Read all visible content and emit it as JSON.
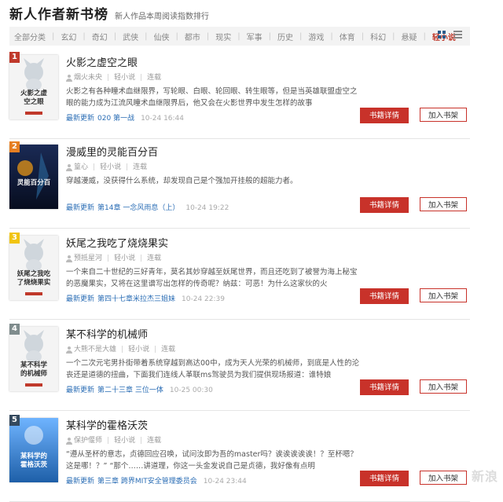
{
  "header": {
    "title": "新人作者新书榜",
    "subtitle": "新人作品本周阅读指数排行"
  },
  "tabs": [
    "全部分类",
    "玄幻",
    "奇幻",
    "武侠",
    "仙侠",
    "都市",
    "现实",
    "军事",
    "历史",
    "游戏",
    "体育",
    "科幻",
    "悬疑",
    "轻小说"
  ],
  "active_tab": "轻小说",
  "buttons": {
    "detail": "书籍详情",
    "shelf": "加入书架"
  },
  "books": [
    {
      "rank": "1",
      "rank_color": "#c0392b",
      "title": "火影之虚空之眼",
      "author": "烟火未央",
      "genre": "轻小说",
      "status": "连载",
      "cover_text": "火影之虚\n空之眼",
      "desc": "火影之有各种瞳术血继限界，写轮眼、白眼、轮回眼、转生眼等，但是当英雄联盟虚空之眼的能力成为江流风瞳术血继限界后，他又会在火影世界中发生怎样的故事",
      "update_label": "最新更新",
      "chapter": "020 第一战",
      "time": "10-24 16:44"
    },
    {
      "rank": "2",
      "rank_color": "#e67e22",
      "title": "漫威里的灵能百分百",
      "author": "篁心",
      "genre": "轻小说",
      "status": "连载",
      "cover_text": "灵能百分百",
      "desc": "穿越漫威，没获得什么系统，却发现自己是个强加开挂般的超能力者。",
      "update_label": "最新更新",
      "chapter": "第14章 一念风雨息（上）",
      "time": "10-24 19:22"
    },
    {
      "rank": "3",
      "rank_color": "#f1c40f",
      "title": "妖尾之我吃了烧烧果实",
      "author": "预抵星河",
      "genre": "轻小说",
      "status": "连载",
      "cover_text": "妖尾之我吃\n了烧烧果实",
      "desc": "一个来自二十世纪的三好青年，莫名其妙穿越至妖尾世界，而且还吃到了被誉为海上秘宝的恶魔果实，又将在这里谱写出怎样的传奇呢？纳兹：可恶！为什么这家伙的火",
      "update_label": "最新更新",
      "chapter": "第四十七章米拉杰三姐妹",
      "time": "10-24 22:39"
    },
    {
      "rank": "4",
      "rank_color": "#7f8c8d",
      "title": "某不科学的机械师",
      "author": "大熊不是大雄",
      "genre": "轻小说",
      "status": "连载",
      "cover_text": "某不科学\n的机械师",
      "desc": "一个二次元宅男扑街带着系统穿越到高达00中，成为天人光荣的机械师，到底是人性的沦丧还是道德的扭曲，下面我们连线人革联ms驾驶员为我们提供现场报道：谁特娘",
      "update_label": "最新更新",
      "chapter": "第二十三章 三位一体",
      "time": "10-25 00:30"
    },
    {
      "rank": "5",
      "rank_color": "#34495e",
      "title": "某科学的霍格沃茨",
      "author": "保护偃师",
      "genre": "轻小说",
      "status": "连载",
      "cover_text": "某科学的\n霍格沃茨",
      "desc": "“遵从圣杯的意志，贞德回应召唤，试问汝即为吾的master吗？诶诶诶诶诶！？至杯嗯？这是哪！？” “那个……讲道理，你这一头金发说自己是贞德，我好像有点明",
      "update_label": "最新更新",
      "chapter": "第三章 跨界MIT安全管理委员会",
      "time": "10-24 23:44"
    }
  ],
  "watermark": "新浪"
}
